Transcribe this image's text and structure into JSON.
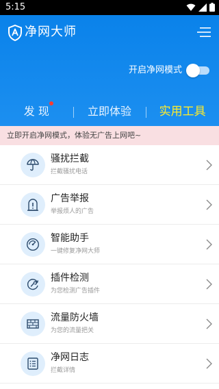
{
  "status": {
    "time": "5:15"
  },
  "header": {
    "title": "净网大师"
  },
  "toggle": {
    "label": "开启净网模式",
    "on": false
  },
  "tabs": [
    {
      "label": "发 现",
      "active": false,
      "badge": true
    },
    {
      "label": "立即体验",
      "active": false,
      "badge": false
    },
    {
      "label": "实用工具",
      "active": true,
      "badge": false
    }
  ],
  "banner": {
    "text": "立即开启净网模式，体验无广告上网吧~"
  },
  "tools": [
    {
      "title": "骚扰拦截",
      "subtitle": "拦截骚扰电话",
      "icon": "umbrella-icon"
    },
    {
      "title": "广告举报",
      "subtitle": "举报烦人的广告",
      "icon": "report-icon"
    },
    {
      "title": "智能助手",
      "subtitle": "一键修复净网大师",
      "icon": "gauge-icon"
    },
    {
      "title": "插件检测",
      "subtitle": "为您检测广告插件",
      "icon": "plugin-scan-icon"
    },
    {
      "title": "流量防火墙",
      "subtitle": "为您的流量把关",
      "icon": "firewall-icon"
    },
    {
      "title": "净网日志",
      "subtitle": "拦截详情",
      "icon": "log-icon"
    }
  ],
  "colors": {
    "primary": "#0a82ea",
    "active_tab": "#ffeb2a",
    "banner_bg": "#f9dfe2",
    "icon_bg": "#dfeefc",
    "badge": "#ff3b30"
  }
}
